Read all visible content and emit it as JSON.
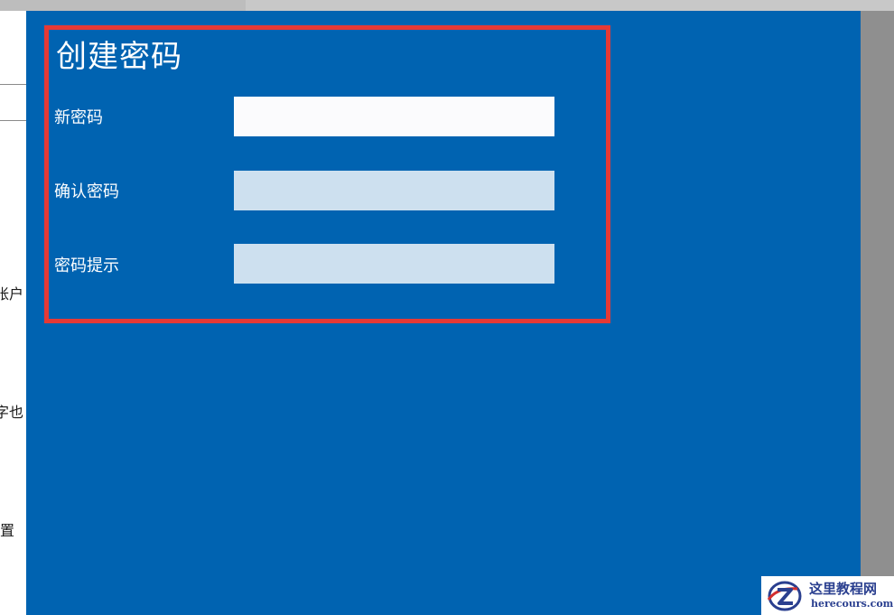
{
  "background": {
    "sidebar_items": [
      {
        "label": "帐户"
      },
      {
        "label": "字也"
      },
      {
        "label": "置"
      }
    ]
  },
  "dialog": {
    "title": "创建密码",
    "fields": [
      {
        "label": "新密码",
        "value": "",
        "state": "focused"
      },
      {
        "label": "确认密码",
        "value": "",
        "state": "idle"
      },
      {
        "label": "密码提示",
        "value": "",
        "state": "idle"
      }
    ]
  },
  "colors": {
    "dialog_background": "#0063b1",
    "highlight_border": "#e53935",
    "input_focused": "#fbfbfd",
    "input_idle": "#cde0ef"
  },
  "watermark": {
    "logo_icon": "z-logo-icon",
    "title": "这里教程网",
    "url": "herecours.com"
  }
}
